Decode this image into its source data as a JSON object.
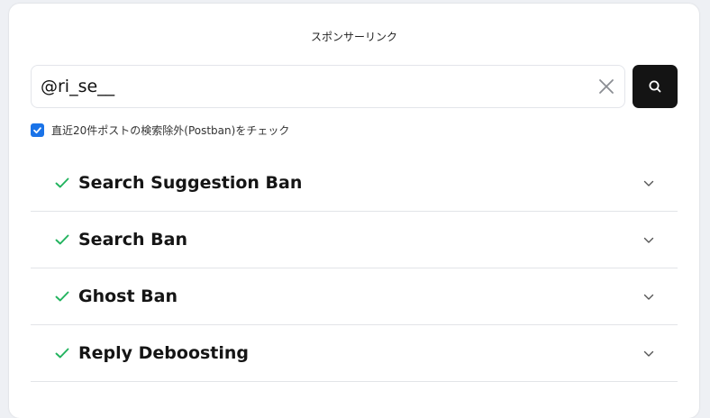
{
  "header": {
    "sponsor_label": "スポンサーリンク"
  },
  "search": {
    "value": "@ri_se__",
    "placeholder": ""
  },
  "options": {
    "exclude_label": "直近20件ポストの検索除外(Postban)をチェック",
    "checked": true
  },
  "results": [
    {
      "label": "Search Suggestion Ban",
      "status": "ok"
    },
    {
      "label": "Search Ban",
      "status": "ok"
    },
    {
      "label": "Ghost Ban",
      "status": "ok"
    },
    {
      "label": "Reply Deboosting",
      "status": "ok"
    }
  ],
  "colors": {
    "accent": "#1a73e8",
    "ok": "#22b35e",
    "button": "#141414"
  }
}
